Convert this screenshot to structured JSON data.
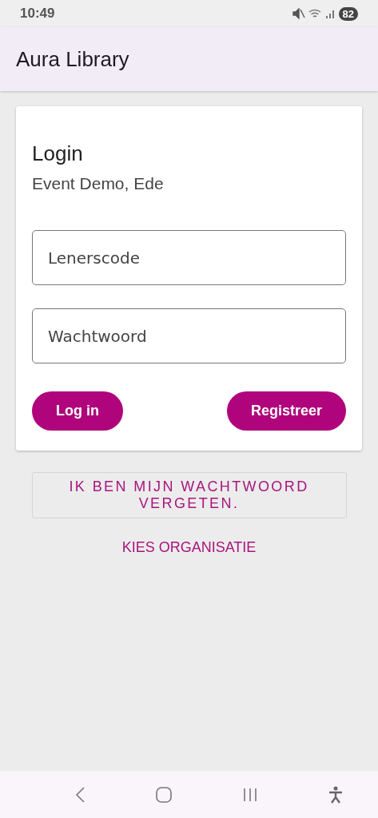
{
  "status_bar": {
    "time": "10:49",
    "battery": "82"
  },
  "app_bar": {
    "title": "Aura Library"
  },
  "login_card": {
    "title": "Login",
    "subtitle": "Event Demo, Ede",
    "fields": [
      {
        "placeholder": "Lenerscode"
      },
      {
        "placeholder": "Wachtwoord"
      }
    ],
    "buttons": [
      "Log in",
      "Registreer"
    ]
  },
  "forgot_password": "IK BEN MIJN WACHTWOORD VERGETEN.",
  "choose_organisation": "KIES ORGANISATIE"
}
